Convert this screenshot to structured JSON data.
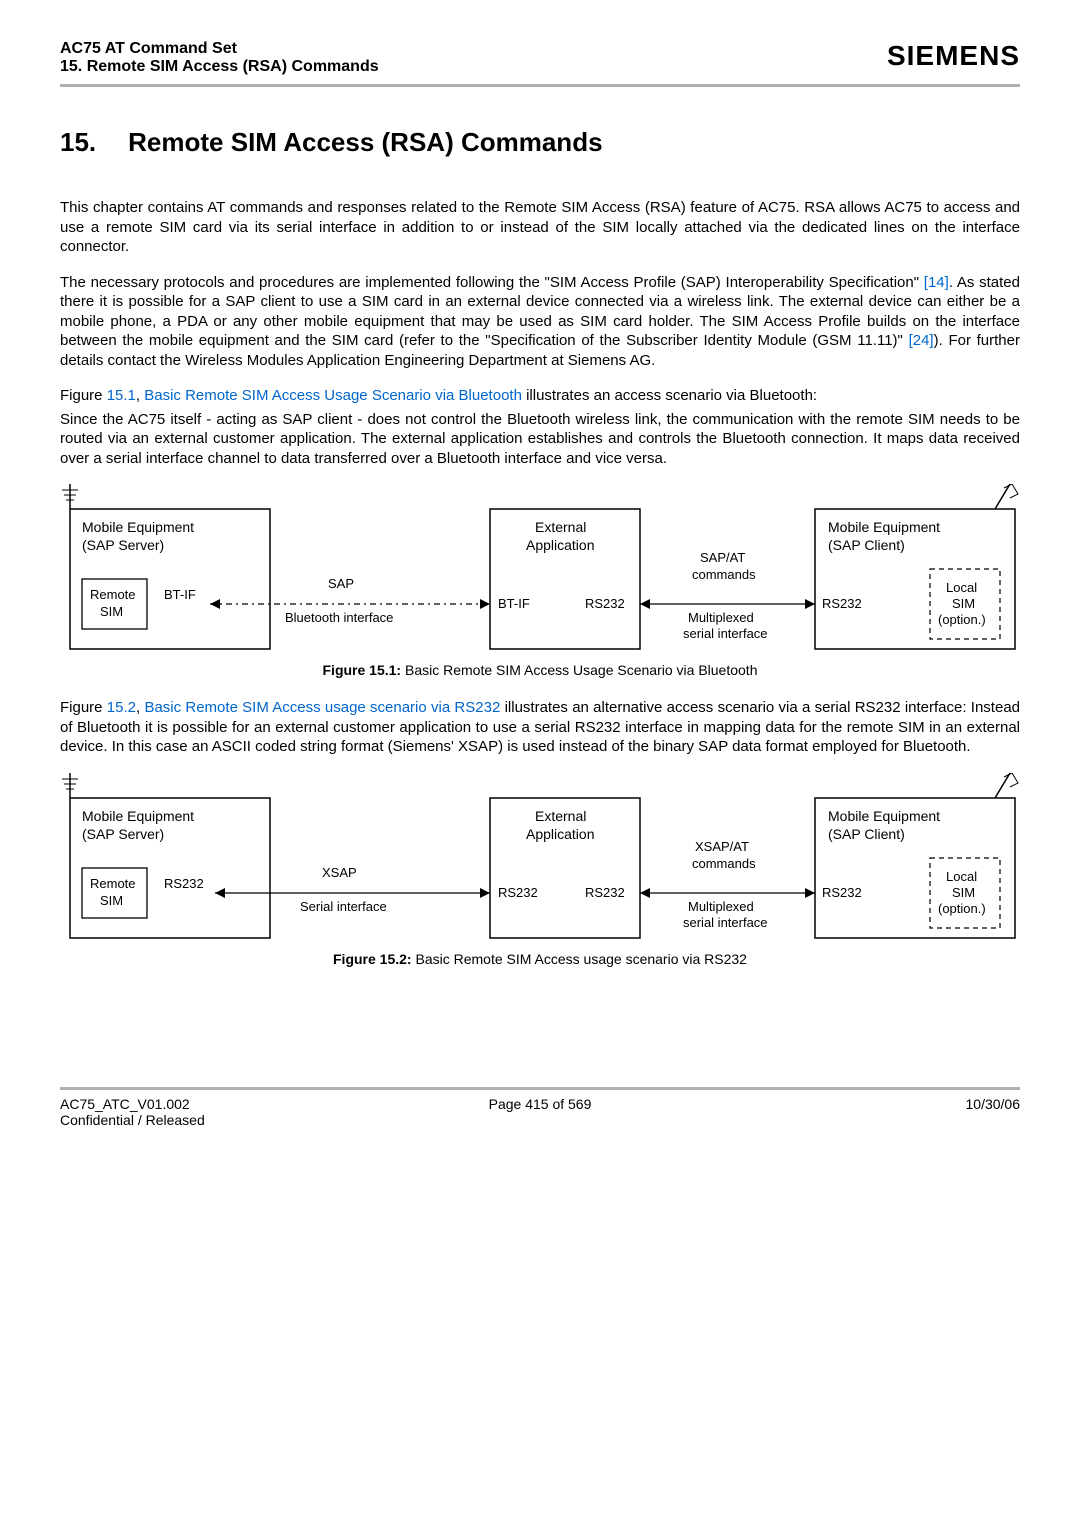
{
  "header": {
    "title": "AC75 AT Command Set",
    "subtitle": "15. Remote SIM Access (RSA) Commands",
    "brand": "SIEMENS"
  },
  "section": {
    "number": "15.",
    "title": "Remote SIM Access (RSA) Commands"
  },
  "para1": "This chapter contains AT commands and responses related to the Remote SIM Access (RSA) feature of AC75. RSA allows AC75 to access and use a remote SIM card via its serial interface in addition to or instead of the SIM locally attached via the dedicated lines on the interface connector.",
  "para2a": "The necessary protocols and procedures are implemented following the \"SIM Access Profile (SAP) Interoperability Specification\" ",
  "para2_ref1": "[14]",
  "para2b": ". As stated there it is possible for a SAP client to use a SIM card in an external device connected via a wireless link. The external device can either be a mobile phone, a PDA or any other mobile equipment that may be used as SIM card holder. The SIM Access Profile builds on the interface between the mobile equipment and the SIM card (refer to the \"Specification of the Subscriber Identity Module (GSM 11.11)\" ",
  "para2_ref2": "[24]",
  "para2c": "). For further details contact the Wireless Modules Application Engineering Department at Siemens AG.",
  "para3a": "Figure ",
  "para3_ref1": "15.1",
  "para3_comma": ", ",
  "para3_ref2": "Basic Remote SIM Access Usage Scenario via Bluetooth",
  "para3b": " illustrates an access scenario via Bluetooth:",
  "para4": "Since the AC75 itself - acting as SAP client - does not control the Bluetooth wireless link, the communication with the remote SIM needs to be routed via an external customer application. The external application establishes and controls the Bluetooth connection. It maps data received over a serial interface channel to data transferred over a Bluetooth interface and vice versa.",
  "fig1": {
    "label": "Figure 15.1:",
    "caption": " Basic Remote SIM Access Usage Scenario via Bluetooth",
    "box_left_l1": "Mobile Equipment",
    "box_left_l2": "(SAP Server)",
    "box_remote_l1": "Remote",
    "box_remote_l2": "SIM",
    "btif": "BT-IF",
    "sap": "SAP",
    "bt_iface": "Bluetooth interface",
    "box_mid_l1": "External",
    "box_mid_l2": "Application",
    "rs232": "RS232",
    "sapat_l1": "SAP/AT",
    "sapat_l2": "commands",
    "mux_l1": "Multiplexed",
    "mux_l2": "serial interface",
    "box_right_l1": "Mobile Equipment",
    "box_right_l2": "(SAP Client)",
    "local_l1": "Local",
    "local_l2": "SIM",
    "local_l3": "(option.)"
  },
  "para5a": "Figure ",
  "para5_ref1": "15.2",
  "para5_comma": ", ",
  "para5_ref2": "Basic Remote SIM Access usage scenario via RS232",
  "para5b": " illustrates an alternative access scenario via a serial RS232 interface: Instead of Bluetooth it is possible for an external customer application to use a serial RS232 interface in mapping data for the remote SIM in an external device. In this case an ASCII coded string format (Siemens' XSAP) is used instead of the binary SAP data format employed for Bluetooth.",
  "fig2": {
    "label": "Figure 15.2:",
    "caption": " Basic Remote SIM Access usage scenario via RS232",
    "box_left_l1": "Mobile Equipment",
    "box_left_l2": "(SAP Server)",
    "box_remote_l1": "Remote",
    "box_remote_l2": "SIM",
    "rs232": "RS232",
    "xsap": "XSAP",
    "serial_iface": "Serial interface",
    "box_mid_l1": "External",
    "box_mid_l2": "Application",
    "xsapat_l1": "XSAP/AT",
    "xsapat_l2": "commands",
    "mux_l1": "Multiplexed",
    "mux_l2": "serial interface",
    "box_right_l1": "Mobile Equipment",
    "box_right_l2": "(SAP Client)",
    "local_l1": "Local",
    "local_l2": "SIM",
    "local_l3": "(option.)"
  },
  "footer": {
    "left": "AC75_ATC_V01.002",
    "center": "Page 415 of 569",
    "right": "10/30/06",
    "below": "Confidential / Released"
  }
}
